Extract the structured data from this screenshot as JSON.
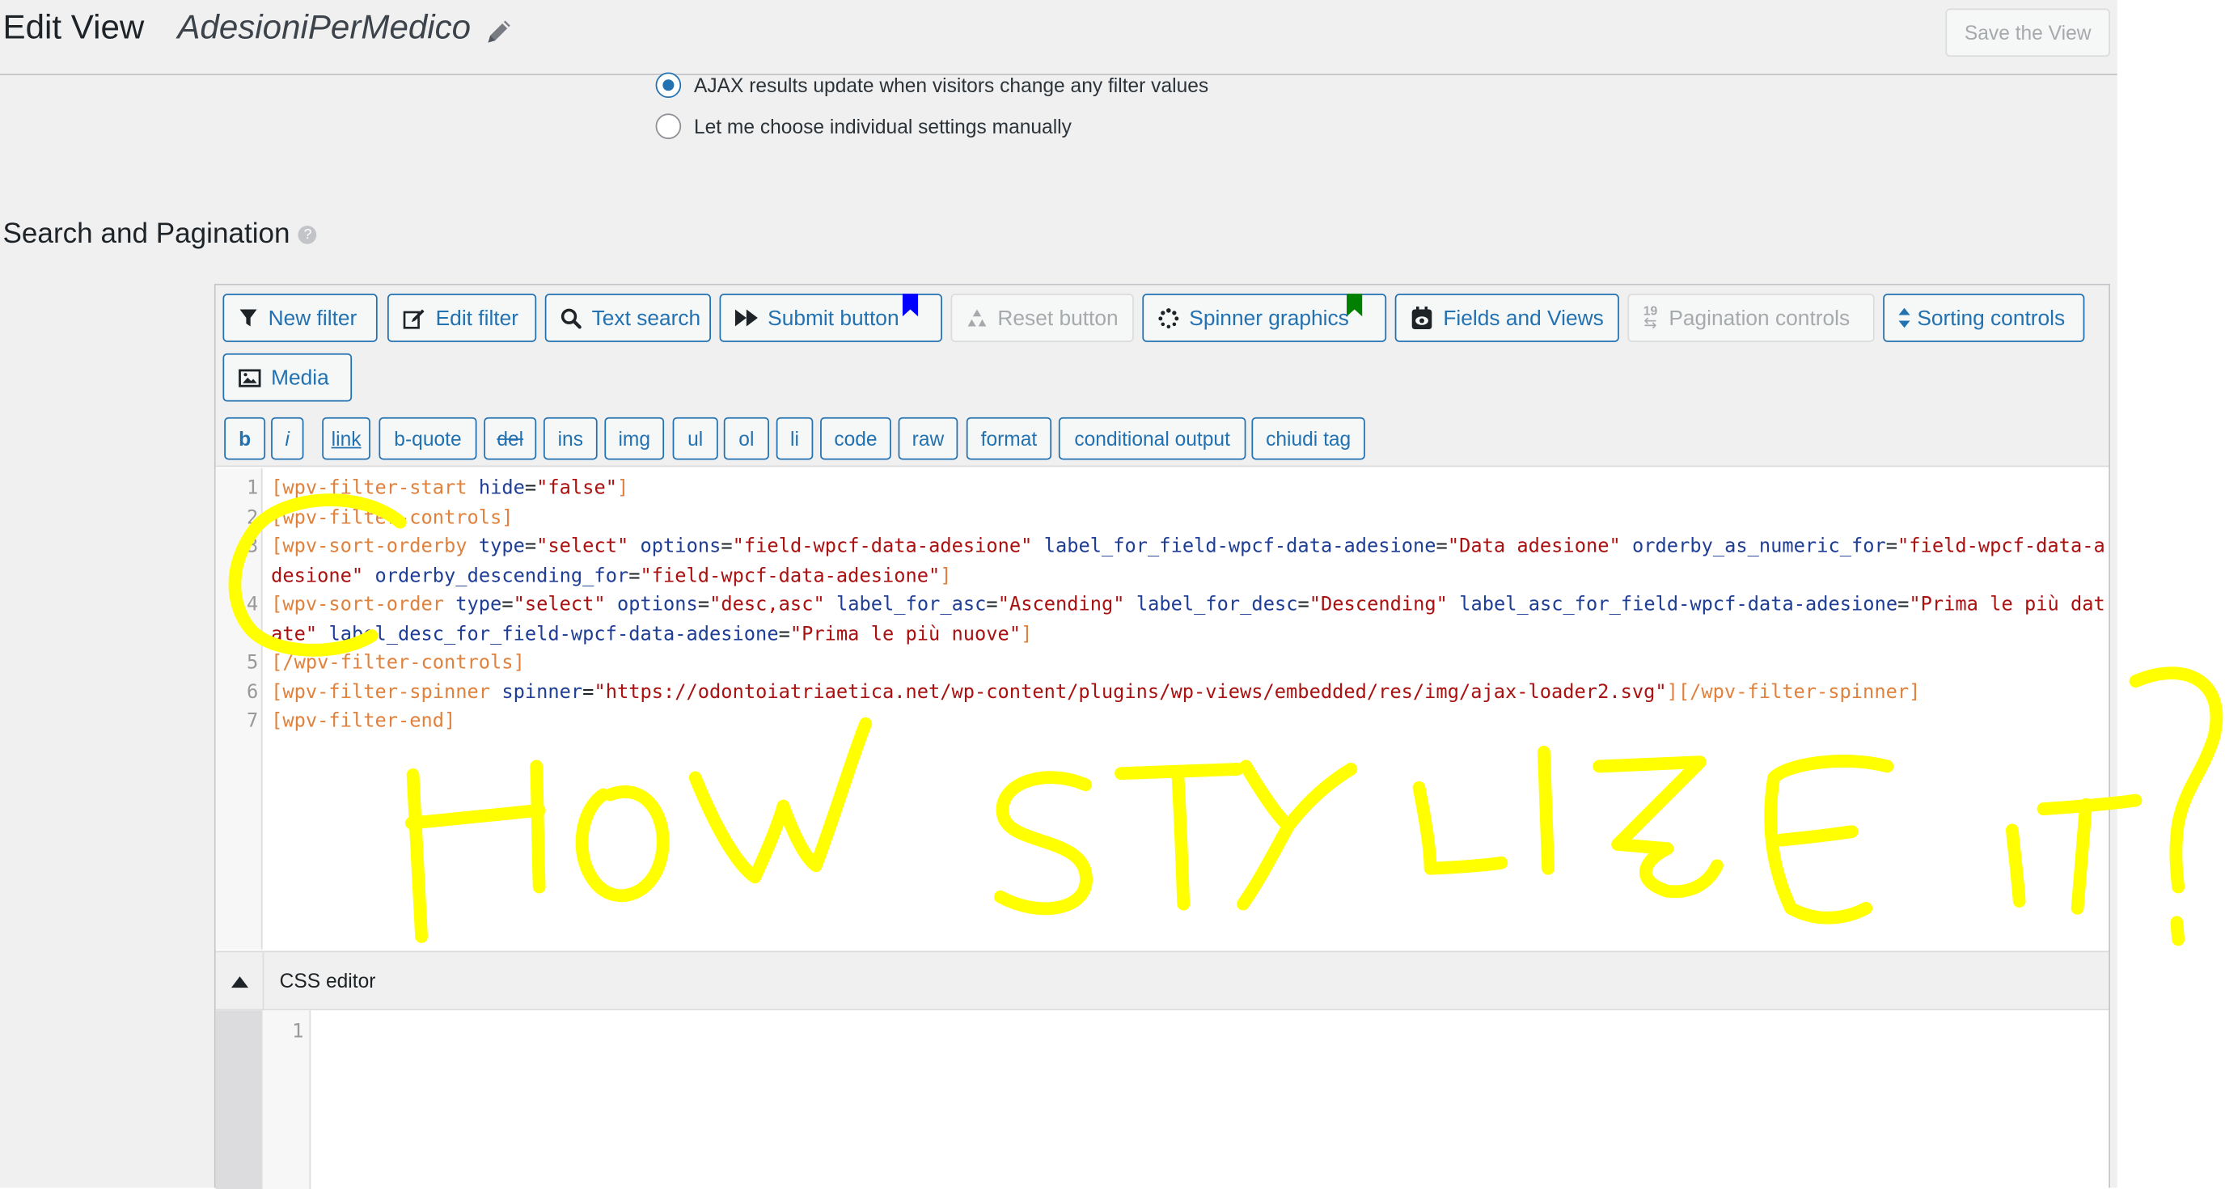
{
  "header": {
    "edit_label": "Edit View",
    "view_name": "AdesioniPerMedico",
    "save_button": "Save the View"
  },
  "ajax_options": [
    {
      "label": "AJAX results update when visitors change any filter values",
      "checked": true
    },
    {
      "label": "Let me choose individual settings manually",
      "checked": false
    }
  ],
  "section": {
    "title": "Search and Pagination",
    "help_glyph": "?"
  },
  "toolbar": {
    "buttons": [
      {
        "label": "New filter",
        "icon": "filter-icon",
        "disabled": false
      },
      {
        "label": "Edit filter",
        "icon": "edit-icon",
        "disabled": false
      },
      {
        "label": "Text search",
        "icon": "search-icon",
        "disabled": false
      },
      {
        "label": "Submit button",
        "icon": "fast-forward-icon",
        "disabled": false,
        "bookmark_color": "#0000ff"
      },
      {
        "label": "Reset button",
        "icon": "recycle-icon",
        "disabled": true
      },
      {
        "label": "Spinner graphics",
        "icon": "spinner-icon",
        "disabled": false,
        "bookmark_color": "#008000"
      },
      {
        "label": "Fields and Views",
        "icon": "views-icon",
        "disabled": false
      },
      {
        "label": "Pagination controls",
        "icon": "pagination-icon",
        "disabled": true
      },
      {
        "label": "Sorting controls",
        "icon": "sort-icon",
        "disabled": false
      },
      {
        "label": "Media",
        "icon": "media-icon",
        "disabled": false
      }
    ],
    "pagination_icon_text": "19"
  },
  "quicktags": [
    "b",
    "i",
    "link",
    "b-quote",
    "del",
    "ins",
    "img",
    "ul",
    "ol",
    "li",
    "code",
    "raw",
    "format",
    "conditional output",
    "chiudi tag"
  ],
  "code_lines": [
    [
      [
        "tag",
        "[wpv-filter-start "
      ],
      [
        "attr",
        "hide"
      ],
      [
        "plain",
        "="
      ],
      [
        "val",
        "\"false\""
      ],
      [
        "tag",
        "]"
      ]
    ],
    [
      [
        "tag",
        "[wpv-filter-controls]"
      ]
    ],
    [
      [
        "tag",
        "[wpv-sort-orderby "
      ],
      [
        "attr",
        "type"
      ],
      [
        "plain",
        "="
      ],
      [
        "val",
        "\"select\""
      ],
      [
        "plain",
        " "
      ],
      [
        "attr",
        "options"
      ],
      [
        "plain",
        "="
      ],
      [
        "val",
        "\"field-wpcf-data-adesione\""
      ],
      [
        "plain",
        " "
      ],
      [
        "attr",
        "label_for_field-wpcf-data-adesione"
      ],
      [
        "plain",
        "="
      ],
      [
        "val",
        "\"Data adesione\""
      ],
      [
        "plain",
        " "
      ],
      [
        "attr",
        "orderby_as_numeric_for"
      ],
      [
        "plain",
        "="
      ],
      [
        "val",
        "\"field-wpcf-data-adesione\""
      ],
      [
        "plain",
        " "
      ],
      [
        "attr",
        "orderby_descending_for"
      ],
      [
        "plain",
        "="
      ],
      [
        "val",
        "\"field-wpcf-data-adesione\""
      ],
      [
        "tag",
        "]"
      ]
    ],
    [
      [
        "tag",
        "[wpv-sort-order "
      ],
      [
        "attr",
        "type"
      ],
      [
        "plain",
        "="
      ],
      [
        "val",
        "\"select\""
      ],
      [
        "plain",
        " "
      ],
      [
        "attr",
        "options"
      ],
      [
        "plain",
        "="
      ],
      [
        "val",
        "\"desc,asc\""
      ],
      [
        "plain",
        " "
      ],
      [
        "attr",
        "label_for_asc"
      ],
      [
        "plain",
        "="
      ],
      [
        "val",
        "\"Ascending\""
      ],
      [
        "plain",
        " "
      ],
      [
        "attr",
        "label_for_desc"
      ],
      [
        "plain",
        "="
      ],
      [
        "val",
        "\"Descending\""
      ],
      [
        "plain",
        " "
      ],
      [
        "attr",
        "label_asc_for_field-wpcf-data-adesione"
      ],
      [
        "plain",
        "="
      ],
      [
        "val",
        "\"Prima le più datate\""
      ],
      [
        "plain",
        " "
      ],
      [
        "attr",
        "label_desc_for_field-wpcf-data-adesione"
      ],
      [
        "plain",
        "="
      ],
      [
        "val",
        "\"Prima le più nuove\""
      ],
      [
        "tag",
        "]"
      ]
    ],
    [
      [
        "tag",
        "[/wpv-filter-controls]"
      ]
    ],
    [
      [
        "tag",
        "[wpv-filter-spinner "
      ],
      [
        "attr",
        "spinner"
      ],
      [
        "plain",
        "="
      ],
      [
        "val",
        "\"https://odontoiatriaetica.net/wp-content/plugins/wp-views/embedded/res/img/ajax-loader2.svg\""
      ],
      [
        "tag",
        "][/wpv-filter-spinner]"
      ]
    ],
    [
      [
        "tag",
        "[wpv-filter-end]"
      ]
    ]
  ],
  "line_numbers": [
    "1",
    "2",
    "3",
    "4",
    "5",
    "6",
    "7"
  ],
  "css_editor": {
    "label": "CSS editor",
    "line_number": "1"
  },
  "annotation": {
    "color": "#ffff00",
    "text": "HOW STYLIZE IT?"
  },
  "colors": {
    "accent": "#2271b1",
    "tag": "#e0823d",
    "attr": "#1f3e95",
    "string": "#aa1111"
  }
}
